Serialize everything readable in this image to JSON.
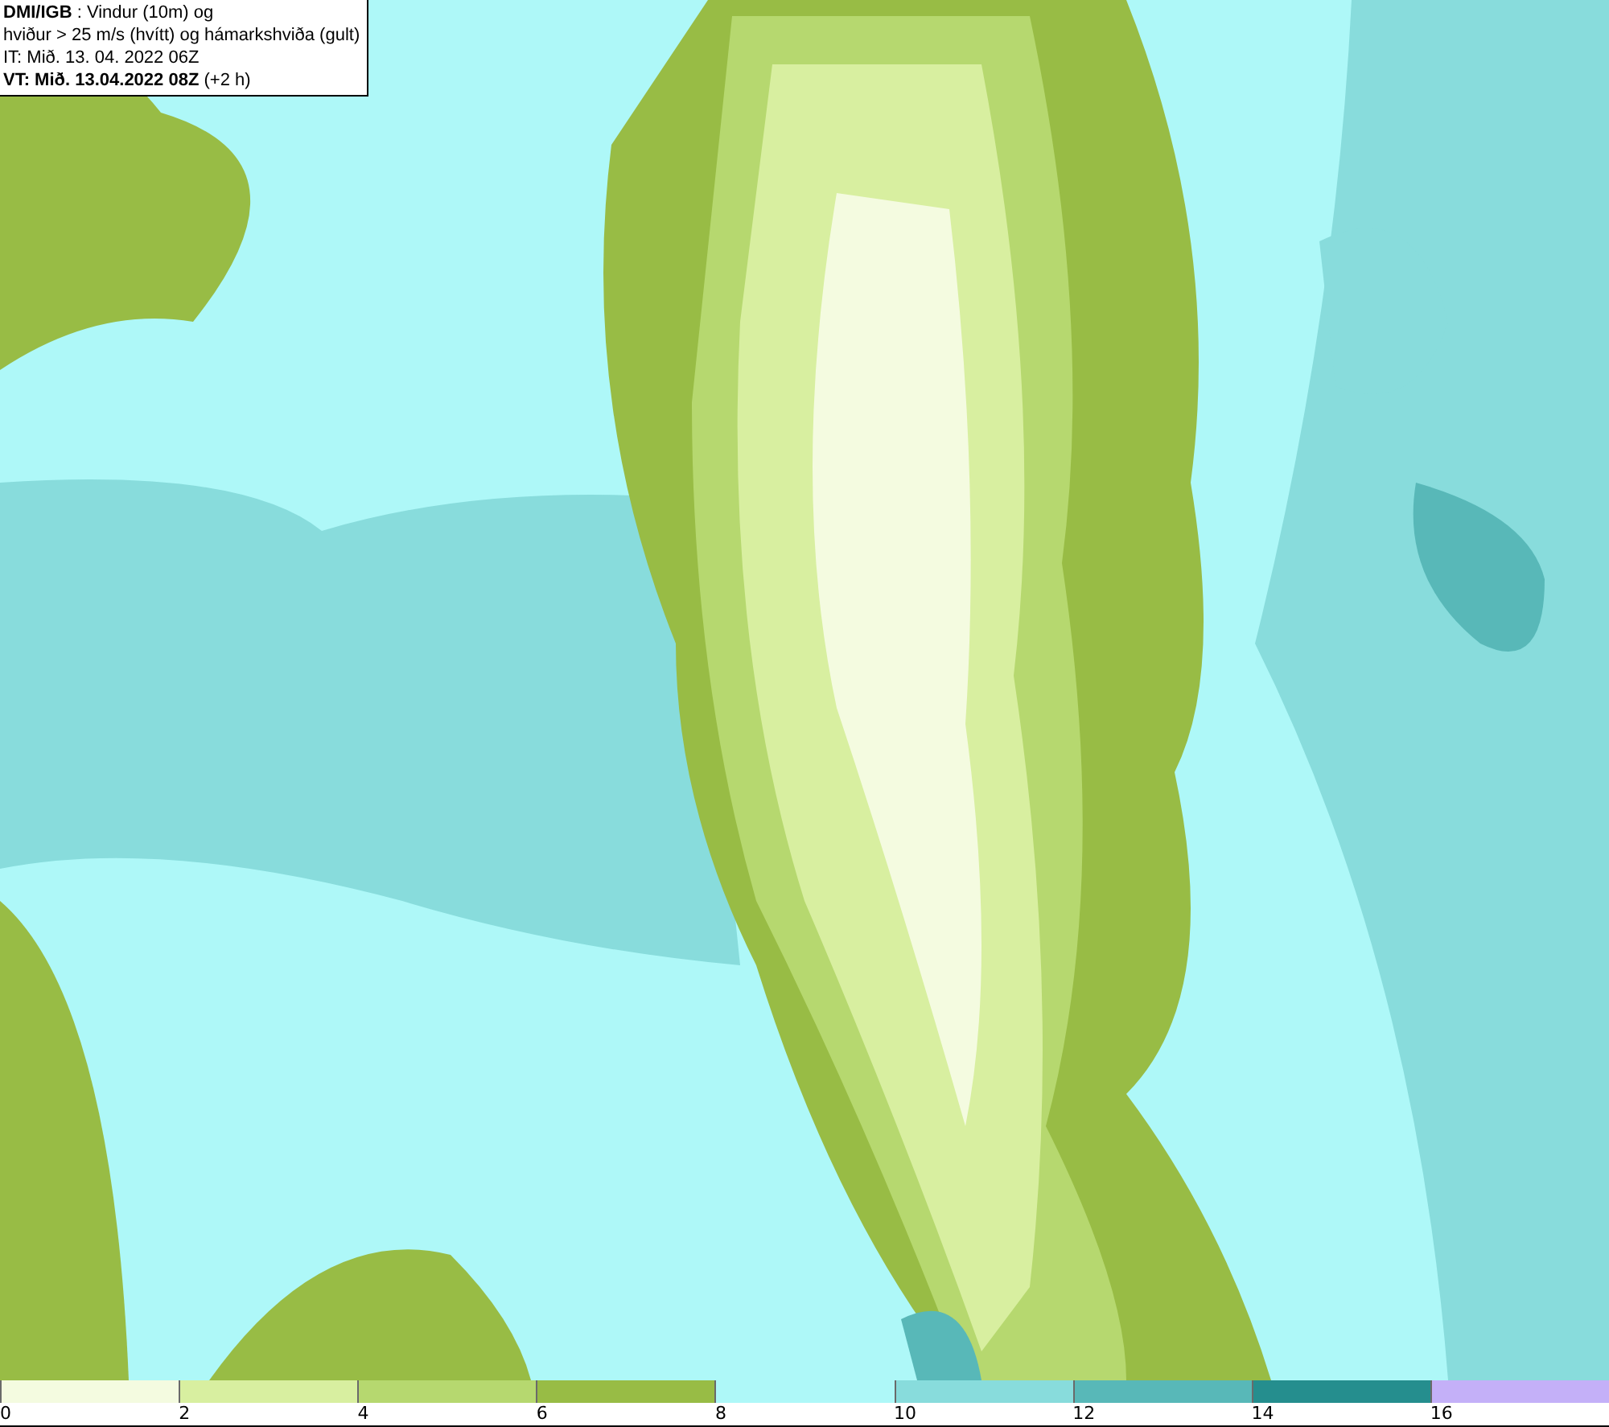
{
  "header": {
    "lines": [
      "**DMI/IGB** : Vindur (10m) og",
      "hviður > 25 m/s (hvítt) og hámarkshviða (gult)",
      "IT: Mið. 13. 04. 2022 06Z",
      "**VT: Mið. 13.04.2022 08Z** (+2 h)"
    ]
  },
  "legend": {
    "bins": [
      {
        "color": "#f4fbe0"
      },
      {
        "color": "#d8efa0"
      },
      {
        "color": "#b6d86f"
      },
      {
        "color": "#98bc45"
      },
      {
        "color": "#aef8f8"
      },
      {
        "color": "#88dcdc"
      },
      {
        "color": "#58b8b8"
      },
      {
        "color": "#258e8e"
      },
      {
        "color": "#c4b0f8"
      }
    ],
    "ticks": [
      "0",
      "2",
      "4",
      "6",
      "8",
      "10",
      "12",
      "14",
      "16"
    ]
  }
}
